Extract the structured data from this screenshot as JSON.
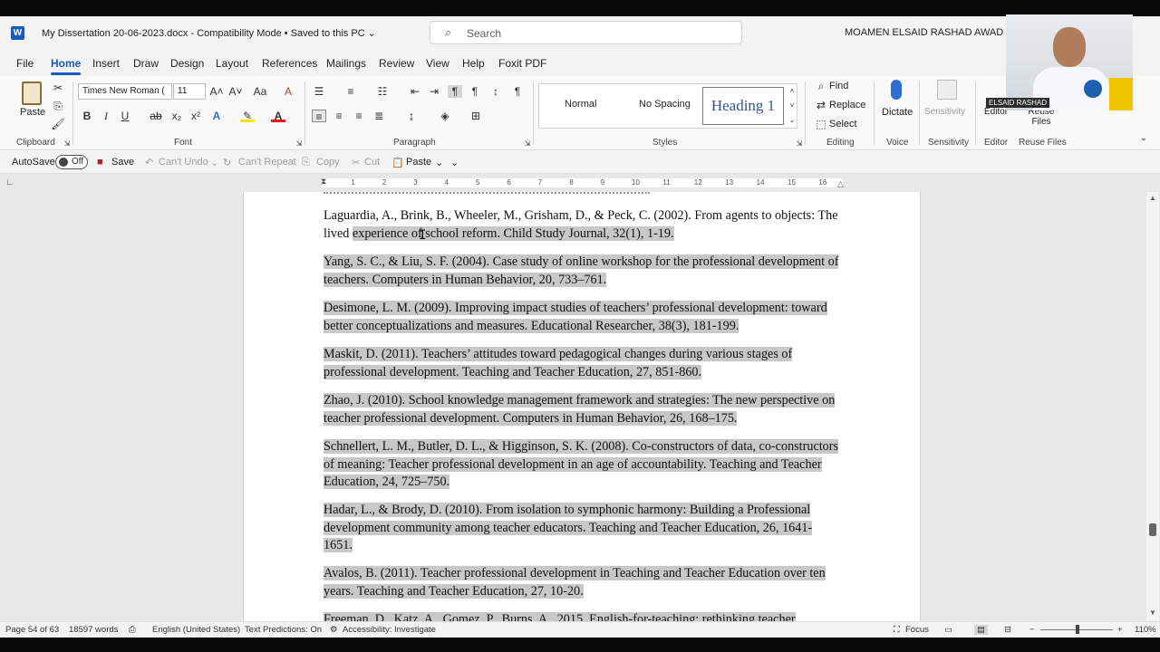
{
  "titlebar": {
    "doc_title": "My Dissertation 20-06-2023.docx  -  Compatibility Mode • Saved to this PC ⌄",
    "search_placeholder": "Search",
    "user_name": "MOAMEN ELSAID RASHAD AWAD",
    "webcam_label": "ELSAID RASHAD"
  },
  "tabs": [
    "File",
    "Home",
    "Insert",
    "Draw",
    "Design",
    "Layout",
    "References",
    "Mailings",
    "Review",
    "View",
    "Help",
    "Foxit PDF"
  ],
  "ribbon": {
    "clipboard": {
      "paste": "Paste",
      "label": "Clipboard"
    },
    "font": {
      "family": "Times New Roman (",
      "size": "11",
      "label": "Font"
    },
    "paragraph": {
      "label": "Paragraph"
    },
    "styles": {
      "normal": "Normal",
      "no_spacing": "No Spacing",
      "heading1": "Heading 1",
      "label": "Styles"
    },
    "editing": {
      "find": "Find",
      "replace": "Replace",
      "select": "Select",
      "label": "Editing"
    },
    "voice": {
      "dictate": "Dictate",
      "label": "Voice"
    },
    "sensitivity": {
      "button": "Sensitivity",
      "label": "Sensitivity"
    },
    "editor": {
      "button": "Editor",
      "label": "Editor"
    },
    "reuse": {
      "button": "Reuse Files",
      "label": "Reuse Files"
    }
  },
  "qat": {
    "autosave": "AutoSave",
    "toggle": "Off",
    "save": "Save",
    "undo": "Can't Undo",
    "repeat": "Can't Repeat",
    "copy": "Copy",
    "cut": "Cut",
    "paste": "Paste"
  },
  "ruler_ticks": [
    "1",
    "2",
    "3",
    "4",
    "5",
    "6",
    "7",
    "8",
    "9",
    "10",
    "11",
    "12",
    "13",
    "14",
    "15",
    "16"
  ],
  "document": {
    "paragraphs": [
      {
        "plain": "Laguardia, A., Brink, B., Wheeler, M., Grisham, D., & Peck, C. (2002). From agents to objects: The lived ",
        "hl": "experience of school reform. Child Study Journal, 32(1), 1-19."
      },
      {
        "plain": "",
        "hl": "Yang, S. C., & Liu, S. F. (2004). Case study of online workshop for the professional development of teachers. Computers in Human Behavior, 20, 733–761."
      },
      {
        "plain": "",
        "hl": "Desimone, L. M. (2009). Improving impact studies of teachers’ professional development: toward better conceptualizations and measures. Educational Researcher, 38(3), 181-199."
      },
      {
        "plain": "",
        "hl": "Maskit, D. (2011). Teachers’ attitudes toward pedagogical changes during various stages of professional development. Teaching and Teacher Education, 27, 851-860."
      },
      {
        "plain": "",
        "hl": "Zhao, J. (2010). School knowledge management framework and strategies: The new perspective on teacher professional development. Computers in Human Behavior, 26, 168–175."
      },
      {
        "plain": "",
        "hl": "Schnellert, L. M., Butler, D. L., & Higginson, S. K. (2008). Co-constructors of data, co-constructors of meaning: Teacher professional development in an age of accountability. Teaching and Teacher Education, 24, 725–750."
      },
      {
        "plain": "",
        "hl": "Hadar, L., & Brody, D. (2010). From isolation to symphonic harmony: Building a Professional development community among teacher educators. Teaching and Teacher Education, 26, 1641-1651."
      },
      {
        "plain": "",
        "hl": "Avalos, B. (2011). Teacher professional development in Teaching and Teacher Education over ten years. Teaching and Teacher Education, 27, 10-20."
      },
      {
        "plain": "",
        "hl": "Freeman, D., Katz, A., Gomez, P., Burns, A., 2015. English-for-teaching: rethinking teacher"
      }
    ]
  },
  "status": {
    "page": "Page 54 of 63",
    "words": "18597 words",
    "language": "English (United States)",
    "predictions": "Text Predictions: On",
    "accessibility": "Accessibility: Investigate",
    "focus": "Focus",
    "zoom": "110%"
  },
  "colors": {
    "accent": "#185abd",
    "selection": "#c8c8c8",
    "heading": "#2f5496"
  }
}
